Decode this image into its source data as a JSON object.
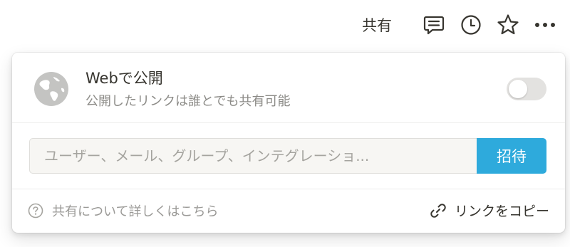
{
  "topbar": {
    "share_label": "共有",
    "icons": [
      "comment-icon",
      "clock-icon",
      "star-icon",
      "more-icon"
    ]
  },
  "publish": {
    "title": "Webで公開",
    "description": "公開したリンクは誰とでも共有可能",
    "toggle_on": false,
    "icon": "globe-icon"
  },
  "invite": {
    "placeholder": "ユーザー、メール、グループ、インテグレーショ...",
    "button_label": "招待"
  },
  "footer": {
    "help_text": "共有について詳しくはこちら",
    "copy_link_label": "リンクをコピー",
    "help_icon": "question-icon",
    "link_icon": "link-icon"
  },
  "colors": {
    "text": "#37352f",
    "muted": "#8c8b87",
    "accent": "#2eaadc",
    "toggle_off": "#e3e2e0",
    "icon_gray": "#c4c4c2"
  }
}
